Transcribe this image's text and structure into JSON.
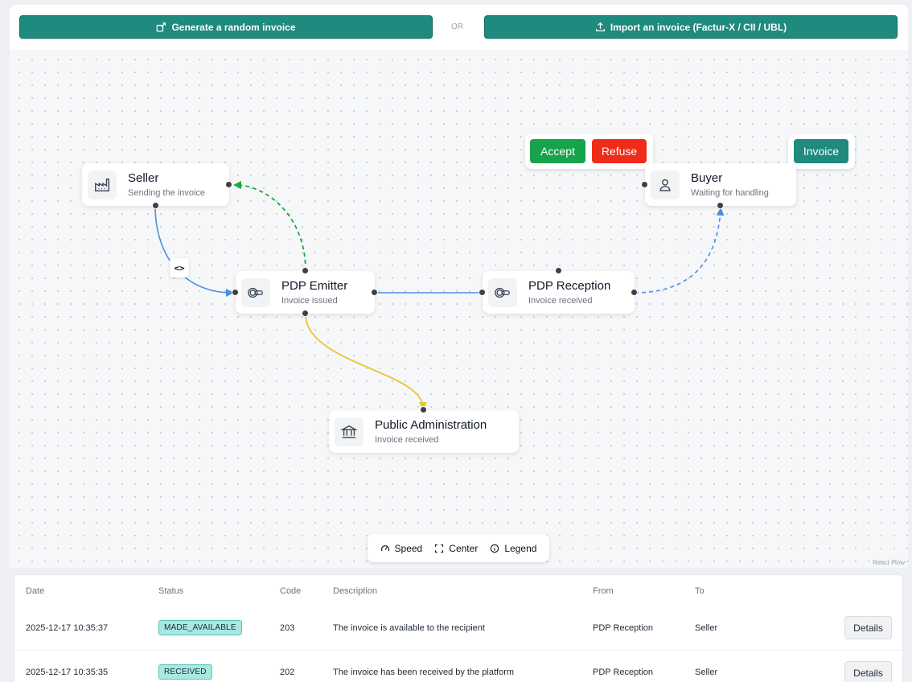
{
  "toolbar": {
    "generate_label": "Generate a random invoice",
    "or_label": "OR",
    "import_label": "Import an invoice (Factur-X / CII / UBL)"
  },
  "flow": {
    "nodes": {
      "seller": {
        "title": "Seller",
        "subtitle": "Sending the invoice"
      },
      "pdp_emitter": {
        "title": "PDP Emitter",
        "subtitle": "Invoice issued"
      },
      "pdp_reception": {
        "title": "PDP Reception",
        "subtitle": "Invoice received"
      },
      "buyer": {
        "title": "Buyer",
        "subtitle": "Waiting for handling"
      },
      "public_admin": {
        "title": "Public Administration",
        "subtitle": "Invoice received"
      }
    },
    "buyer_actions": {
      "accept": "Accept",
      "refuse": "Refuse",
      "invoice": "Invoice"
    },
    "edge_colors": {
      "blue": "#4a90e2",
      "green": "#1aa83a",
      "yellow": "#e8c531"
    },
    "action_colors": {
      "accept": "#16a34a",
      "refuse": "#ef2b1a",
      "invoice": "#1f8a7e"
    },
    "controls": {
      "speed": "Speed",
      "center": "Center",
      "legend": "Legend"
    },
    "attribution": "React Flow"
  },
  "table": {
    "headers": [
      "Date",
      "Status",
      "Code",
      "Description",
      "From",
      "To"
    ],
    "details_label": "Details",
    "rows": [
      {
        "date": "2025-12-17 10:35:37",
        "status": "MADE_AVAILABLE",
        "code": "203",
        "description": "The invoice is available to the recipient",
        "from": "PDP Reception",
        "to": "Seller"
      },
      {
        "date": "2025-12-17 10:35:35",
        "status": "RECEIVED",
        "code": "202",
        "description": "The invoice has been received by the platform",
        "from": "PDP Reception",
        "to": "Seller"
      }
    ]
  }
}
